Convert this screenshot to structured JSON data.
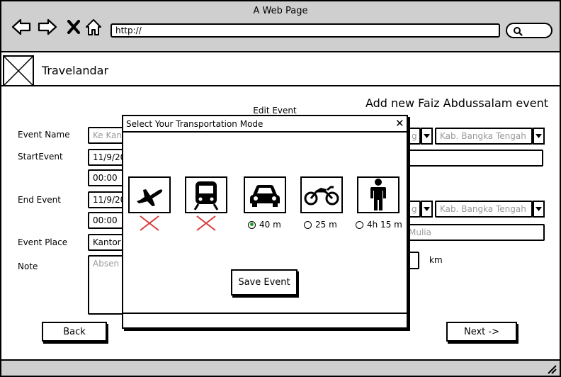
{
  "browser": {
    "title": "A Web Page",
    "url": "http://"
  },
  "app": {
    "name": "Travelandar",
    "page_heading": "Add new Faiz Abdussalam event",
    "form_heading": "Edit Event"
  },
  "form": {
    "event_name": {
      "label": "Event Name",
      "value": "Ke Kan",
      "city_1": "g",
      "city_2": "Kab. Bangka Tengah"
    },
    "start_event": {
      "label": "StartEvent",
      "date": "11/9/20",
      "time": "00:00"
    },
    "end_event": {
      "label": "End Event",
      "date": "11/9/20",
      "time": "00:00",
      "city_1": "g",
      "city_2": "Kab. Bangka Tengah",
      "place_suffix": "Mulia"
    },
    "event_place": {
      "label": "Event Place",
      "value": "Kantor"
    },
    "note": {
      "label": "Note",
      "value": "Absen"
    },
    "distance_unit": "km"
  },
  "buttons": {
    "back": "Back",
    "next": "Next ->"
  },
  "modal": {
    "title": "Select Your Transportation Mode",
    "close": "✕",
    "save": "Save Event",
    "modes": [
      {
        "icon": "airplane-icon",
        "available": false,
        "time": ""
      },
      {
        "icon": "train-icon",
        "available": false,
        "time": ""
      },
      {
        "icon": "car-icon",
        "available": true,
        "selected": true,
        "time": "40 m"
      },
      {
        "icon": "motorcycle-icon",
        "available": true,
        "selected": false,
        "time": "25 m"
      },
      {
        "icon": "walking-person-icon",
        "available": true,
        "selected": false,
        "time": "4h 15 m"
      }
    ]
  },
  "colors": {
    "chrome": "#cfcfcf",
    "selected_radio": "#19a119",
    "unavailable_mark": "#d93a3a",
    "placeholder_text": "#9a9a9a"
  }
}
